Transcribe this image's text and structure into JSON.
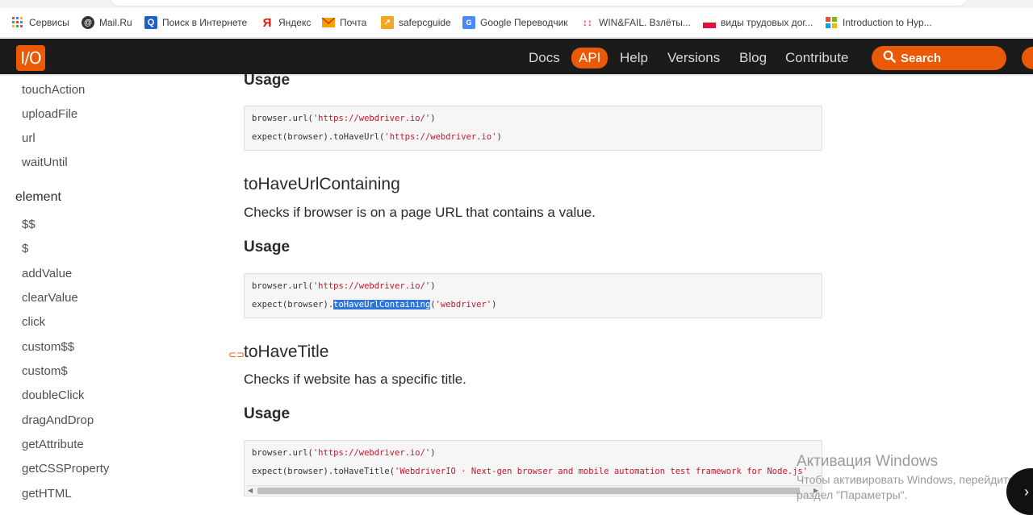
{
  "bookmarks": [
    {
      "label": "Сервисы",
      "icon": "apps-grid-icon"
    },
    {
      "label": "Mail.Ru",
      "icon": "mailru-icon"
    },
    {
      "label": "Поиск в Интернете",
      "icon": "search-q-icon"
    },
    {
      "label": "Яндекс",
      "icon": "yandex-icon"
    },
    {
      "label": "Почта",
      "icon": "mail-icon"
    },
    {
      "label": "safepcguide",
      "icon": "safepcguide-icon"
    },
    {
      "label": "Google Переводчик",
      "icon": "translate-icon"
    },
    {
      "label": "WIN&FAIL. Взлёты...",
      "icon": "winfail-icon"
    },
    {
      "label": "виды трудовых дог...",
      "icon": "flag-icon"
    },
    {
      "label": "Introduction to Hyp...",
      "icon": "microsoft-icon"
    }
  ],
  "navbar": {
    "logo": "I/O",
    "links": [
      "Docs",
      "API",
      "Help",
      "Versions",
      "Blog",
      "Contribute"
    ],
    "active": "API",
    "search_placeholder": "Search"
  },
  "sidebar": {
    "top_items": [
      "touchAction",
      "uploadFile",
      "url",
      "waitUntil"
    ],
    "section": "element",
    "element_items": [
      "$$",
      "$",
      "addValue",
      "clearValue",
      "click",
      "custom$$",
      "custom$",
      "doubleClick",
      "dragAndDrop",
      "getAttribute",
      "getCSSProperty",
      "getHTML"
    ]
  },
  "content": {
    "usage_label": "Usage",
    "block1": {
      "l1_pre": "browser.url(",
      "l1_str": "'https://webdriver.io/'",
      "l1_post": ")",
      "l2_pre": "expect(browser).toHaveUrl(",
      "l2_str": "'https://webdriver.io'",
      "l2_post": ")"
    },
    "section2": {
      "title": "toHaveUrlContaining",
      "desc": "Checks if browser is on a page URL that contains a value.",
      "l1_pre": "browser.url(",
      "l1_str": "'https://webdriver.io/'",
      "l1_post": ")",
      "l2_pre": "expect(browser).",
      "l2_sel": "toHaveUrlContaining",
      "l2_mid": "(",
      "l2_str": "'webdriver'",
      "l2_post": ")"
    },
    "section3": {
      "title": "toHaveTitle",
      "desc": "Checks if website has a specific title.",
      "l1_pre": "browser.url(",
      "l1_str": "'https://webdriver.io/'",
      "l1_post": ")",
      "l2_pre": "expect(browser).toHaveTitle(",
      "l2_str": "'WebdriverIO · Next-gen browser and mobile automation test framework for Node.js'"
    }
  },
  "watermark": {
    "title": "Активация Windows",
    "line1": "Чтобы активировать Windows, перейдите в",
    "line2": "раздел \"Параметры\"."
  }
}
